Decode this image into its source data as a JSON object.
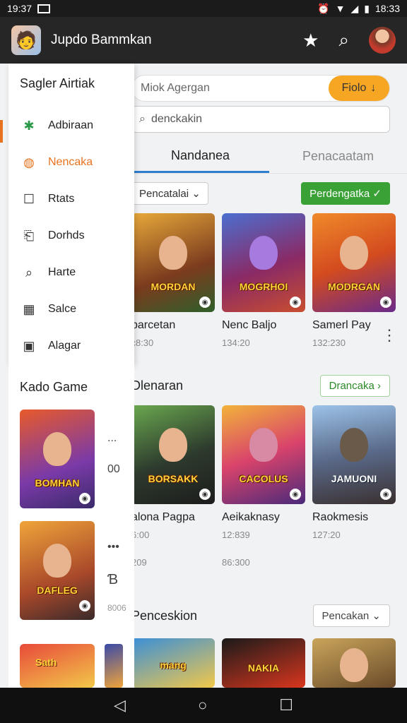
{
  "status": {
    "time_left": "19:37",
    "time_right": "18:33"
  },
  "appbar": {
    "title": "Jupdo Bammkan"
  },
  "search": {
    "field1": "Miok Agergan",
    "filter_label": "Fiolo",
    "field2_placeholder": "denckakin"
  },
  "tabs": [
    {
      "label": "Nandanea"
    },
    {
      "label": "Penacaatam"
    }
  ],
  "drawer": {
    "header": "Sagler Airtiak",
    "items": [
      {
        "label": "Adbiraan",
        "icon": "puzzle-icon"
      },
      {
        "label": "Nencaka",
        "icon": "gamepad-icon"
      },
      {
        "label": "Rtats",
        "icon": "square-icon"
      },
      {
        "label": "Dorhds",
        "icon": "clipboard-icon"
      },
      {
        "label": "Harte",
        "icon": "search-icon"
      },
      {
        "label": "Salce",
        "icon": "calendar-icon"
      },
      {
        "label": "Alagar",
        "icon": "box-icon"
      }
    ]
  },
  "section1": {
    "chip": "Pencatalai",
    "button": "Perdengatka",
    "cards": [
      {
        "thumb_title": "MORDAN",
        "title": "barcetan",
        "time": "ɛ8:30"
      },
      {
        "thumb_title": "MOGRHOI",
        "title": "Nenc Baljo",
        "time": "134:20"
      },
      {
        "thumb_title": "MODRGAN",
        "title": "Samerl Pay",
        "time": "132:230"
      }
    ]
  },
  "section2": {
    "title": "Dlenaran",
    "button": "Drancaka",
    "cards": [
      {
        "thumb_title": "BORSAKK",
        "title": "alona Pagpa",
        "time": "6:00"
      },
      {
        "thumb_title": "CACOLUS",
        "title": "Aeikaknasy",
        "time": "12:839"
      },
      {
        "thumb_title": "JAMUONI",
        "title": "Raokmesis",
        "time": "127:20"
      }
    ],
    "extra_times": [
      "209",
      "86:300"
    ]
  },
  "section3": {
    "title": "Penceskion",
    "dropdown": "Pencakan",
    "thumb_titles": [
      "mang",
      "NAKIA",
      ""
    ]
  },
  "left_panel": {
    "title": "Kado Game",
    "cards": [
      {
        "thumb_title": "BOMHAN"
      },
      {
        "thumb_title": "DAFLEG"
      },
      {
        "thumb_title": "Sath"
      }
    ],
    "side_labels": [
      "...",
      "00",
      "•••",
      "Ɓ",
      "8006"
    ]
  }
}
